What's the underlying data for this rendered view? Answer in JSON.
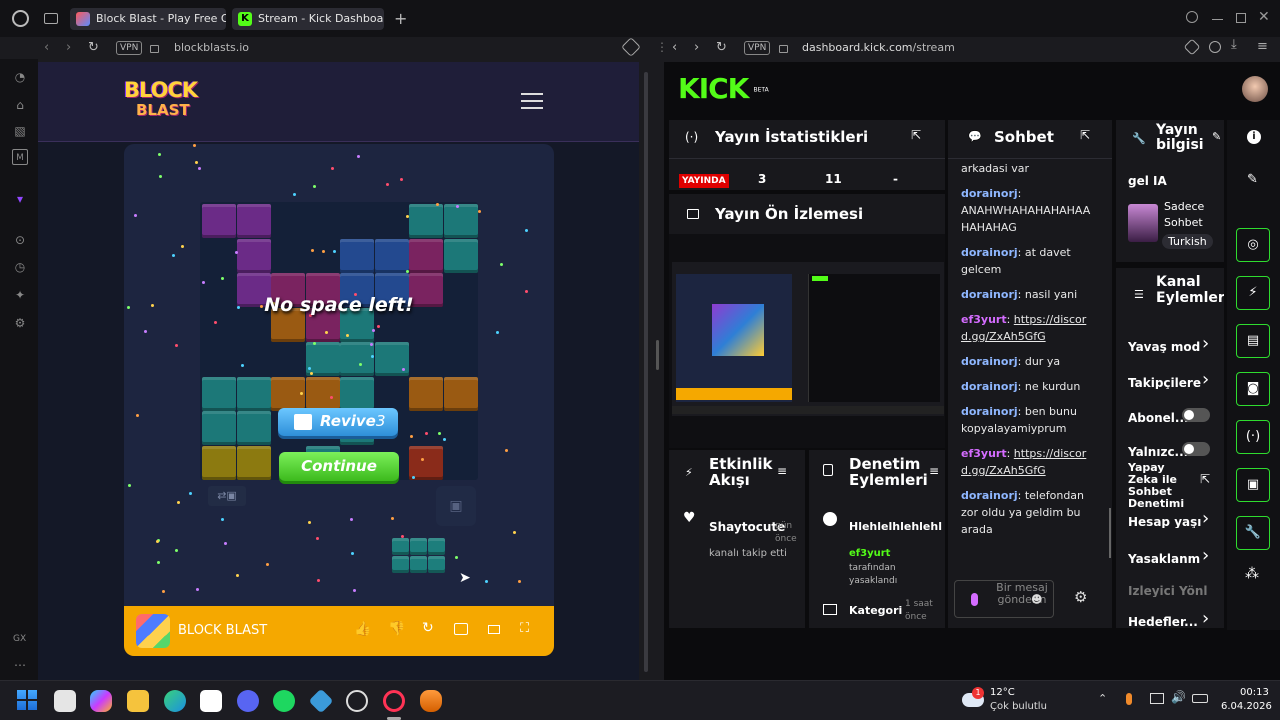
{
  "tabs": [
    {
      "title": "Block Blast - Play Free Onli"
    },
    {
      "title": "Stream - Kick Dashboard"
    }
  ],
  "left_address": {
    "vpn": "VPN",
    "url": "blockblasts.io"
  },
  "right_address": {
    "vpn": "VPN",
    "url_host": "dashboard.kick.com",
    "url_path": "/stream"
  },
  "game": {
    "logo_line1": "BLOCK",
    "logo_line2": "BLAST",
    "overlay_text": "No space left!",
    "revive_label": "Revive",
    "revive_count": "3",
    "continue_label": "Continue",
    "bar_title": "BLOCK BLAST"
  },
  "kick": {
    "logo": "KICK",
    "logo_badge": "BETA",
    "stats": {
      "title": "Yayın İstatistikleri",
      "live_badge": "YAYINDA",
      "values": [
        "3",
        "11",
        "-"
      ]
    },
    "preview": {
      "title": "Yayın Ön İzlemesi"
    },
    "activity": {
      "title": "Etkinlik Akışı",
      "user": "Shaytocute",
      "time": "gün önce",
      "text": "kanalı takip etti"
    },
    "moderation": {
      "title": "Denetim Eylemleri",
      "action": "Hlehlelhlehlehl",
      "by_user": "ef3yurt",
      "by_text": "tarafından yasaklandı",
      "category_label": "Kategori",
      "category_time": "1 saat önce"
    },
    "chat": {
      "title": "Sohbet",
      "messages": [
        {
          "user": "",
          "text": "arkadasi var"
        },
        {
          "user": "dorainorj",
          "text": "ANAHWHAHAHAHAHAA HAHAHAG"
        },
        {
          "user": "dorainorj",
          "text": "at davet gelcem"
        },
        {
          "user": "dorainorj",
          "text": "nasil yani"
        },
        {
          "user": "ef3yurt",
          "text": "https://discord.gg/ZxAh5GfG"
        },
        {
          "user": "dorainorj",
          "text": "dur ya"
        },
        {
          "user": "dorainorj",
          "text": "ne kurdun"
        },
        {
          "user": "dorainorj",
          "text": "ben bunu kopyalayamiyprum"
        },
        {
          "user": "ef3yurt",
          "text": "https://discord.gg/ZxAh5GfG"
        },
        {
          "user": "dorainorj",
          "text": "telefondan zor oldu ya geldim bu arada"
        }
      ],
      "input_placeholder": "Bir mesaj gönderin"
    },
    "info": {
      "title_line1": "Yayın",
      "title_line2": "bilgisi",
      "stream_title": "gel IA",
      "tags": [
        "Sadece",
        "Sohbet"
      ],
      "language": "Turkish"
    },
    "channel_actions": {
      "title_line1": "Kanal",
      "title_line2": "Eylemleri",
      "items": [
        {
          "label": "Yavaş mod",
          "kind": "arrow"
        },
        {
          "label": "Takipçilere",
          "kind": "arrow"
        },
        {
          "label": "Abonel...",
          "kind": "toggle"
        },
        {
          "label": "Yalnızc...",
          "kind": "toggle"
        },
        {
          "label": "Yapay Zeka ile Sohbet Denetimi",
          "kind": "external"
        },
        {
          "label": "Hesap yaşı",
          "kind": "arrow"
        },
        {
          "label": "Yasaklanm",
          "kind": "arrow"
        },
        {
          "label": "İzleyici Yönlendir",
          "kind": "none"
        },
        {
          "label": "Hedefler...",
          "kind": "arrow"
        }
      ]
    }
  },
  "taskbar": {
    "weather_temp": "12°C",
    "weather_desc": "Çok bulutlu",
    "weather_badge": "1",
    "time": "00:13",
    "date": "6.04.2026"
  },
  "sidebar": {
    "gx_label": "GX"
  },
  "colors": {
    "kick_green": "#53fc18",
    "game_orange": "#f5a800",
    "live_red": "#e00000"
  }
}
